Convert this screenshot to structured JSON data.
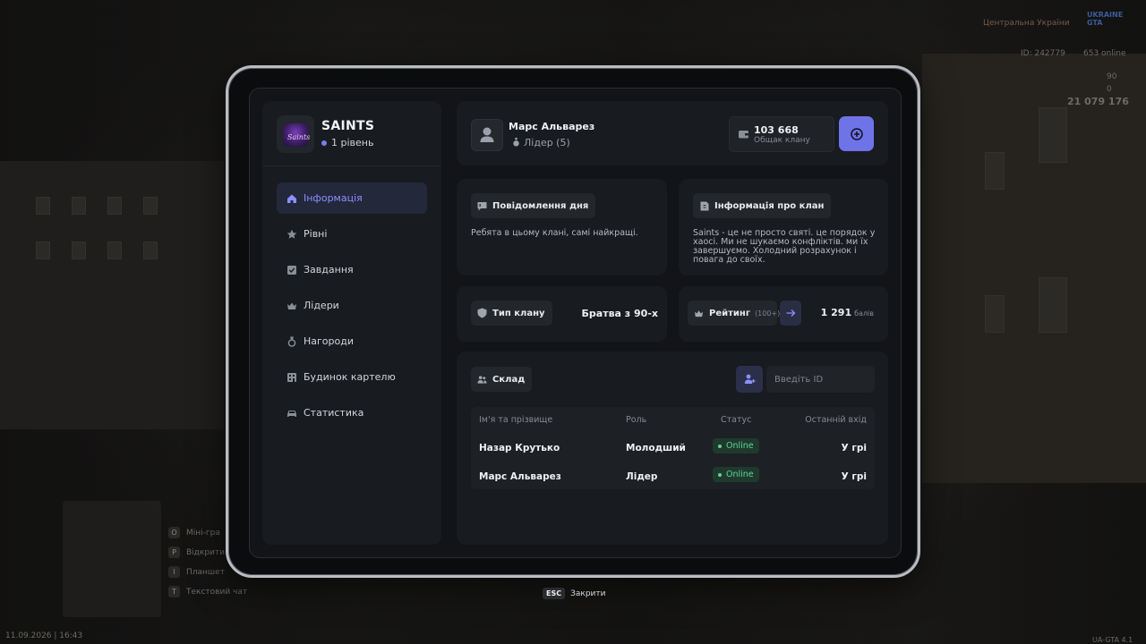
{
  "clan": {
    "name": "SAINTS",
    "level_label": "1 рівень",
    "logo_text": "Saints"
  },
  "sidebar": {
    "items": [
      {
        "label": "Інформація",
        "icon": "home-icon",
        "active": true
      },
      {
        "label": "Рівні",
        "icon": "star-icon",
        "active": false
      },
      {
        "label": "Завдання",
        "icon": "checkbox-icon",
        "active": false
      },
      {
        "label": "Лідери",
        "icon": "crown-icon",
        "active": false
      },
      {
        "label": "Нагороди",
        "icon": "medal-icon",
        "active": false
      },
      {
        "label": "Будинок картелю",
        "icon": "building-icon",
        "active": false
      },
      {
        "label": "Статистика",
        "icon": "car-icon",
        "active": false
      }
    ]
  },
  "header": {
    "user_name": "Марс Альварез",
    "user_role": "Лідер (5)",
    "bank_value": "103 668",
    "bank_label": "Общак клану"
  },
  "motd": {
    "title": "Повідомлення дня",
    "text": "Ребята в цьому клані, самі найкращі."
  },
  "clan_info": {
    "title": "Інформація про клан",
    "text": "Saints - це не просто святі. це порядок у хаосі. Ми не шукаємо конфліктів. ми їх завершуємо. Холодний розрахунок і повага до своїх."
  },
  "clan_type": {
    "label": "Тип клану",
    "value": "Братва з 90-х"
  },
  "rating": {
    "label": "Рейтинг",
    "sub": "(100+)",
    "score": "1 291",
    "unit": "балів"
  },
  "members": {
    "title": "Склад",
    "search_placeholder": "Введіть ID",
    "columns": [
      "Ім'я та прізвище",
      "Роль",
      "Статус",
      "Останній вхід"
    ],
    "rows": [
      {
        "name": "Назар Крутько",
        "role": "Молодший",
        "status": "Online",
        "last": "У грі"
      },
      {
        "name": "Марс Альварез",
        "role": "Лідер",
        "status": "Online",
        "last": "У грі"
      }
    ]
  },
  "footer": {
    "esc_key": "ESC",
    "esc_label": "Закрити"
  },
  "hud": {
    "region": "Центральна України",
    "player_id": "ID: 242779",
    "online": "653 online",
    "money": "21 079 176",
    "health": "90",
    "armor": "0",
    "datetime": "11.09.2026 | 16:43",
    "version": "UA-GTA 4.1",
    "logo": "UKRAINE GTA",
    "hints": [
      "Міні-гра",
      "Відкрити",
      "Планшет",
      "Текстовий чат"
    ],
    "hint_keys": [
      "O",
      "P",
      "I",
      "T"
    ]
  },
  "colors": {
    "accent": "#6f73e8",
    "online": "#5fd39a",
    "panel": "#181b1f",
    "screen": "#121417"
  }
}
